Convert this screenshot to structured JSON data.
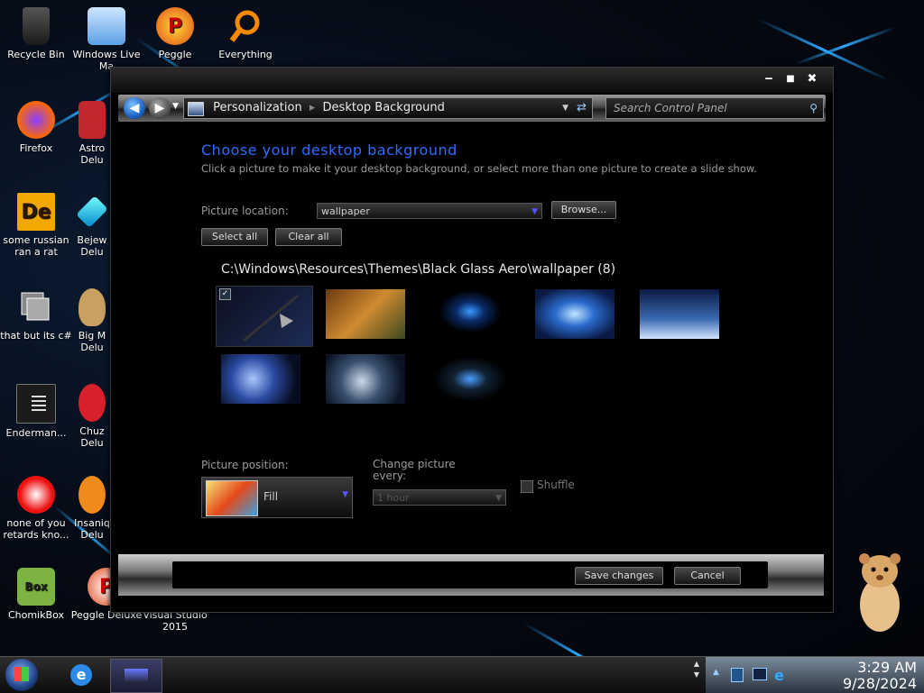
{
  "desktop": {
    "icons": [
      {
        "label": "Recycle Bin"
      },
      {
        "label": "Windows Live Ma"
      },
      {
        "label": "Peggle"
      },
      {
        "label": "Everything"
      },
      {
        "label": "Firefox"
      },
      {
        "label": "Astro Delu"
      },
      {
        "label": "some russian ran a rat"
      },
      {
        "label": "Bejew Delu"
      },
      {
        "label": "that but its c#"
      },
      {
        "label": "Big M Delu"
      },
      {
        "label": "Enderman..."
      },
      {
        "label": "Chuz Delu"
      },
      {
        "label": "none of you retards kno..."
      },
      {
        "label": "Insaniq Delu"
      },
      {
        "label": "ChomikBox"
      },
      {
        "label": "Peggle Deluxe"
      },
      {
        "label": "Visual Studio 2015"
      }
    ]
  },
  "window": {
    "controls": {
      "minimize": "‒",
      "maximize": "■",
      "close": "✖"
    },
    "address": {
      "part1": "Personalization",
      "part2": "Desktop Background"
    },
    "search_placeholder": "Search Control Panel",
    "heading": "Choose your desktop background",
    "subtext": "Click a picture to make it your desktop background, or select more than one picture to create a slide show.",
    "picture_location_label": "Picture location:",
    "picture_location_value": "wallpaper",
    "browse_label": "Browse...",
    "select_all_label": "Select all",
    "clear_all_label": "Clear all",
    "folder_path": "C:\\Windows\\Resources\\Themes\\Black Glass Aero\\wallpaper (8)",
    "thumb_count": 8,
    "picture_position_label": "Picture position:",
    "picture_position_value": "Fill",
    "change_picture_label": "Change picture every:",
    "change_picture_value": "1 hour",
    "shuffle_label": "Shuffle",
    "save_label": "Save changes",
    "cancel_label": "Cancel"
  },
  "taskbar": {
    "time": "3:29 AM",
    "date": "9/28/2024"
  },
  "colors": {
    "accent": "#2f6bff",
    "window_bg": "#000000"
  }
}
